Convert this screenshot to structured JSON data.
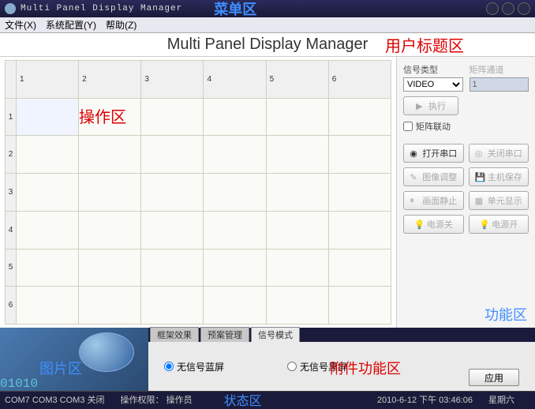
{
  "window": {
    "title": "Multi Panel Display Manager",
    "annotation_menu": "菜单区"
  },
  "menu": {
    "file": "文件(X)",
    "config": "系统配置(Y)",
    "help": "帮助(Z)"
  },
  "user_title": {
    "text": "Multi Panel Display Manager",
    "annotation": "用户标题区"
  },
  "grid": {
    "cols": [
      "1",
      "2",
      "3",
      "4",
      "5",
      "6"
    ],
    "rows": [
      "1",
      "2",
      "3",
      "4",
      "5",
      "6"
    ],
    "annotation": "操作区"
  },
  "func": {
    "signal_type_label": "信号类型",
    "signal_type_value": "VIDEO",
    "matrix_channel_label": "矩阵通道",
    "matrix_channel_value": "1",
    "execute": "执行",
    "matrix_link": "矩阵联动",
    "open_port": "打开串口",
    "close_port": "关闭串口",
    "img_tune": "图像调整",
    "host_save": "主机保存",
    "screen_freeze": "画面静止",
    "unit_display": "单元显示",
    "power_off": "电源关",
    "power_on": "电源开",
    "annotation": "功能区"
  },
  "tabs": {
    "frame_effect": "框架效果",
    "preset_mgmt": "预案管理",
    "signal_mode": "信号模式",
    "nosignal_blue": "无信号蓝屏",
    "nosignal_black": "无信号黑屏",
    "apply": "应用",
    "annotation": "附件功能区",
    "img_annotation": "图片区"
  },
  "status": {
    "ports": "COM7 COM3 COM3 关闭",
    "perm_label": "操作权限：",
    "perm_value": "操作员",
    "annotation": "状态区",
    "datetime": "2010-6-12 下午 03:46:06",
    "weekday": "星期六"
  }
}
